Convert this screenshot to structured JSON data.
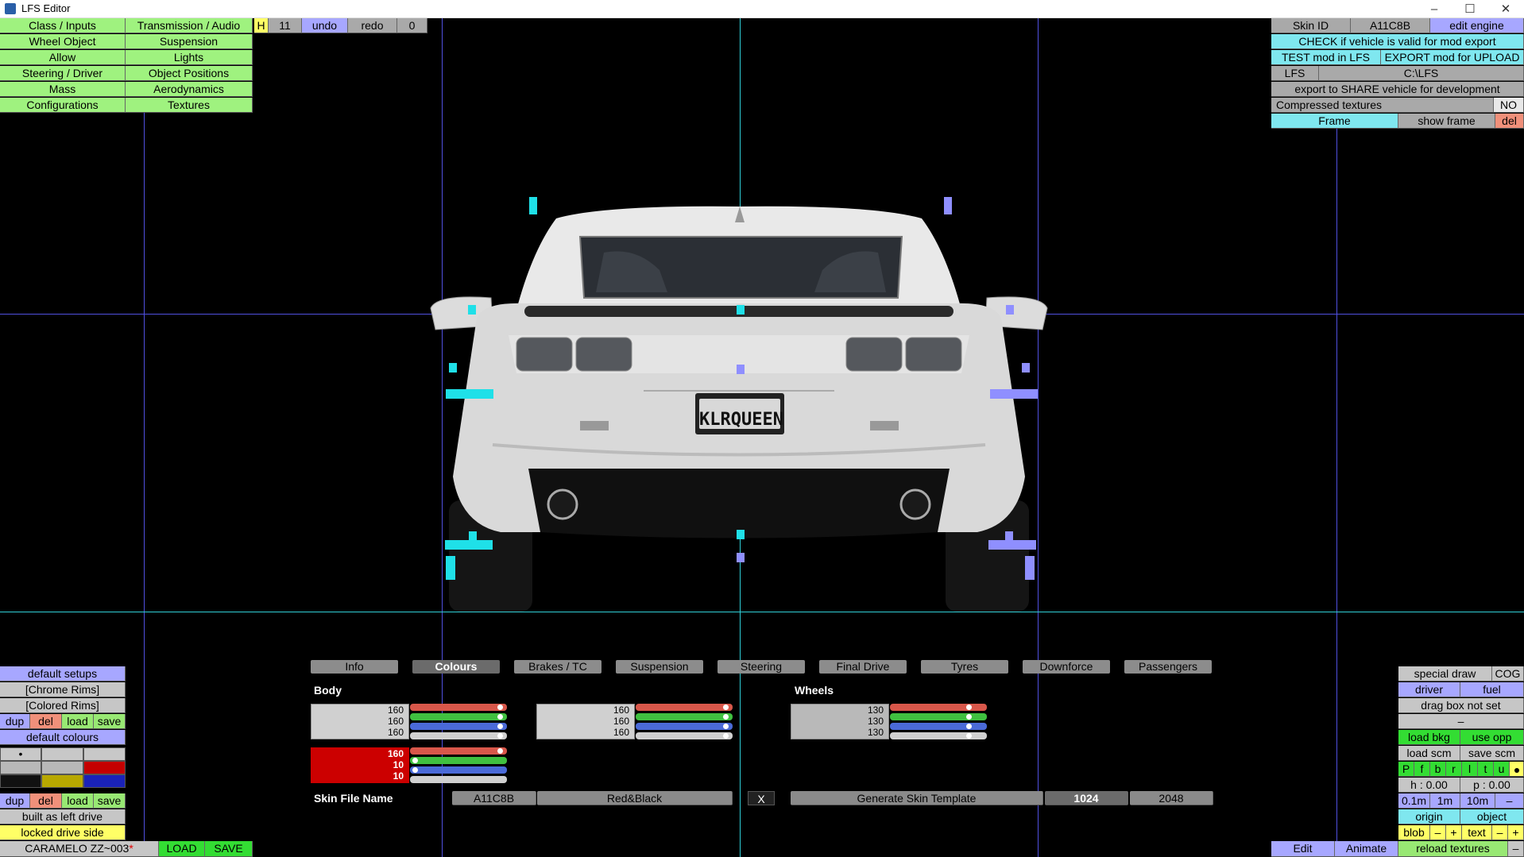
{
  "window": {
    "title": "LFS Editor",
    "minimize": "–",
    "maximize": "☐",
    "close": "✕"
  },
  "top_left_menu": [
    [
      "Class / Inputs",
      "Transmission / Audio"
    ],
    [
      "Wheel Object",
      "Suspension"
    ],
    [
      "Allow",
      "Lights"
    ],
    [
      "Steering / Driver",
      "Object Positions"
    ],
    [
      "Mass",
      "Aerodynamics"
    ],
    [
      "Configurations",
      "Textures"
    ]
  ],
  "history": {
    "h": "H",
    "count": "11",
    "undo": "undo",
    "redo": "redo",
    "redo_count": "0"
  },
  "top_right": {
    "skin_id_label": "Skin ID",
    "skin_id_value": "A11C8B",
    "edit_engine": "edit engine",
    "check_valid": "CHECK if vehicle is valid for mod export",
    "test_mod": "TEST mod in LFS",
    "export_mod": "EXPORT mod for UPLOAD",
    "lfs_label": "LFS",
    "lfs_path": "C:\\LFS",
    "export_share": "export to SHARE vehicle for development",
    "compressed_label": "Compressed textures",
    "compressed_value": "NO",
    "frame": "Frame",
    "show_frame": "show frame",
    "del": "del"
  },
  "license_plate": "KLRQUEEN",
  "tabs": [
    "Info",
    "Colours",
    "Brakes / TC",
    "Suspension",
    "Steering",
    "Final Drive",
    "Tyres",
    "Downforce",
    "Passengers"
  ],
  "active_tab": "Colours",
  "colours": {
    "body_label": "Body",
    "wheels_label": "Wheels",
    "body_primary": [
      "160",
      "160",
      "160"
    ],
    "body_secondary": [
      "160",
      "160",
      "160"
    ],
    "body_accent": [
      "160",
      "10",
      "10"
    ],
    "wheels": [
      "130",
      "130",
      "130"
    ],
    "accent_color": "#cc0000"
  },
  "skin": {
    "label": "Skin File Name",
    "id": "A11C8B",
    "name": "Red&Black",
    "clear": "X",
    "generate": "Generate Skin Template",
    "size_1024": "1024",
    "size_2048": "2048"
  },
  "left_panel": {
    "default_setups": "default setups",
    "chrome_rims": "[Chrome Rims]",
    "colored_rims": "[Colored Rims]",
    "dup": "dup",
    "del": "del",
    "load": "load",
    "save": "save",
    "default_colours": "default colours",
    "swatch_selected": "•",
    "built_as": "built as left drive",
    "locked_side": "locked drive side"
  },
  "bottom_left": {
    "vehicle": "CARAMELO ZZ~003",
    "modified_mark": "*",
    "load": "LOAD",
    "save": "SAVE"
  },
  "right_panel": {
    "special_draw": "special draw",
    "cog": "COG",
    "driver": "driver",
    "fuel": "fuel",
    "drag_box": "drag box not set",
    "dash": "–",
    "load_bkg": "load bkg",
    "use_opp": "use opp",
    "load_scm": "load scm",
    "save_scm": "save scm",
    "view_letters": [
      "P",
      "f",
      "b",
      "r",
      "l",
      "t",
      "u"
    ],
    "h_val": "h : 0.00",
    "p_val": "p : 0.00",
    "step_01": "0.1m",
    "step_1": "1m",
    "step_10": "10m",
    "minus": "–",
    "origin": "origin",
    "object": "object",
    "blob": "blob",
    "plus": "+",
    "text": "text"
  },
  "bottom_right": {
    "edit": "Edit",
    "animate": "Animate",
    "reload": "reload textures",
    "minus": "–"
  }
}
